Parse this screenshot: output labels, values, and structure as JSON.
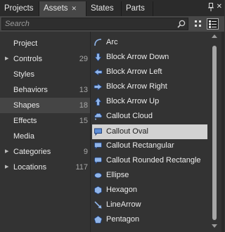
{
  "tabs": [
    {
      "label": "Projects",
      "active": false
    },
    {
      "label": "Assets",
      "active": true,
      "close": "✕"
    },
    {
      "label": "States",
      "active": false
    },
    {
      "label": "Parts",
      "active": false
    }
  ],
  "panel": {
    "close_glyph": "✕"
  },
  "search": {
    "placeholder": "Search",
    "value": ""
  },
  "categories": [
    {
      "label": "Project",
      "count": "",
      "expandable": false,
      "selected": false
    },
    {
      "label": "Controls",
      "count": "29",
      "expandable": true,
      "selected": false
    },
    {
      "label": "Styles",
      "count": "",
      "expandable": false,
      "selected": false
    },
    {
      "label": "Behaviors",
      "count": "13",
      "expandable": false,
      "selected": false
    },
    {
      "label": "Shapes",
      "count": "18",
      "expandable": false,
      "selected": true
    },
    {
      "label": "Effects",
      "count": "15",
      "expandable": false,
      "selected": false
    },
    {
      "label": "Media",
      "count": "",
      "expandable": false,
      "selected": false
    },
    {
      "label": "Categories",
      "count": "9",
      "expandable": true,
      "selected": false
    },
    {
      "label": "Locations",
      "count": "117",
      "expandable": true,
      "selected": false
    }
  ],
  "shapes": [
    {
      "label": "Arc",
      "icon": "arc-icon"
    },
    {
      "label": "Block Arrow Down",
      "icon": "arrow-down-icon"
    },
    {
      "label": "Block Arrow Left",
      "icon": "arrow-left-icon"
    },
    {
      "label": "Block Arrow Right",
      "icon": "arrow-right-icon"
    },
    {
      "label": "Block Arrow Up",
      "icon": "arrow-up-icon"
    },
    {
      "label": "Callout Cloud",
      "icon": "callout-cloud-icon"
    },
    {
      "label": "Callout Oval",
      "icon": "callout-oval-icon",
      "selected": true
    },
    {
      "label": "Callout Rectangular",
      "icon": "callout-rectangular-icon"
    },
    {
      "label": "Callout Rounded Rectangle",
      "icon": "callout-rounded-icon"
    },
    {
      "label": "Ellipse",
      "icon": "ellipse-icon"
    },
    {
      "label": "Hexagon",
      "icon": "hexagon-icon"
    },
    {
      "label": "LineArrow",
      "icon": "line-arrow-icon"
    },
    {
      "label": "Pentagon",
      "icon": "pentagon-icon"
    }
  ],
  "colors": {
    "background": "#333333",
    "tab_active": "#474747",
    "selection_left": "#454545",
    "selection_right": "#d2d2d2",
    "icon_blue": "#8fb4e8"
  }
}
